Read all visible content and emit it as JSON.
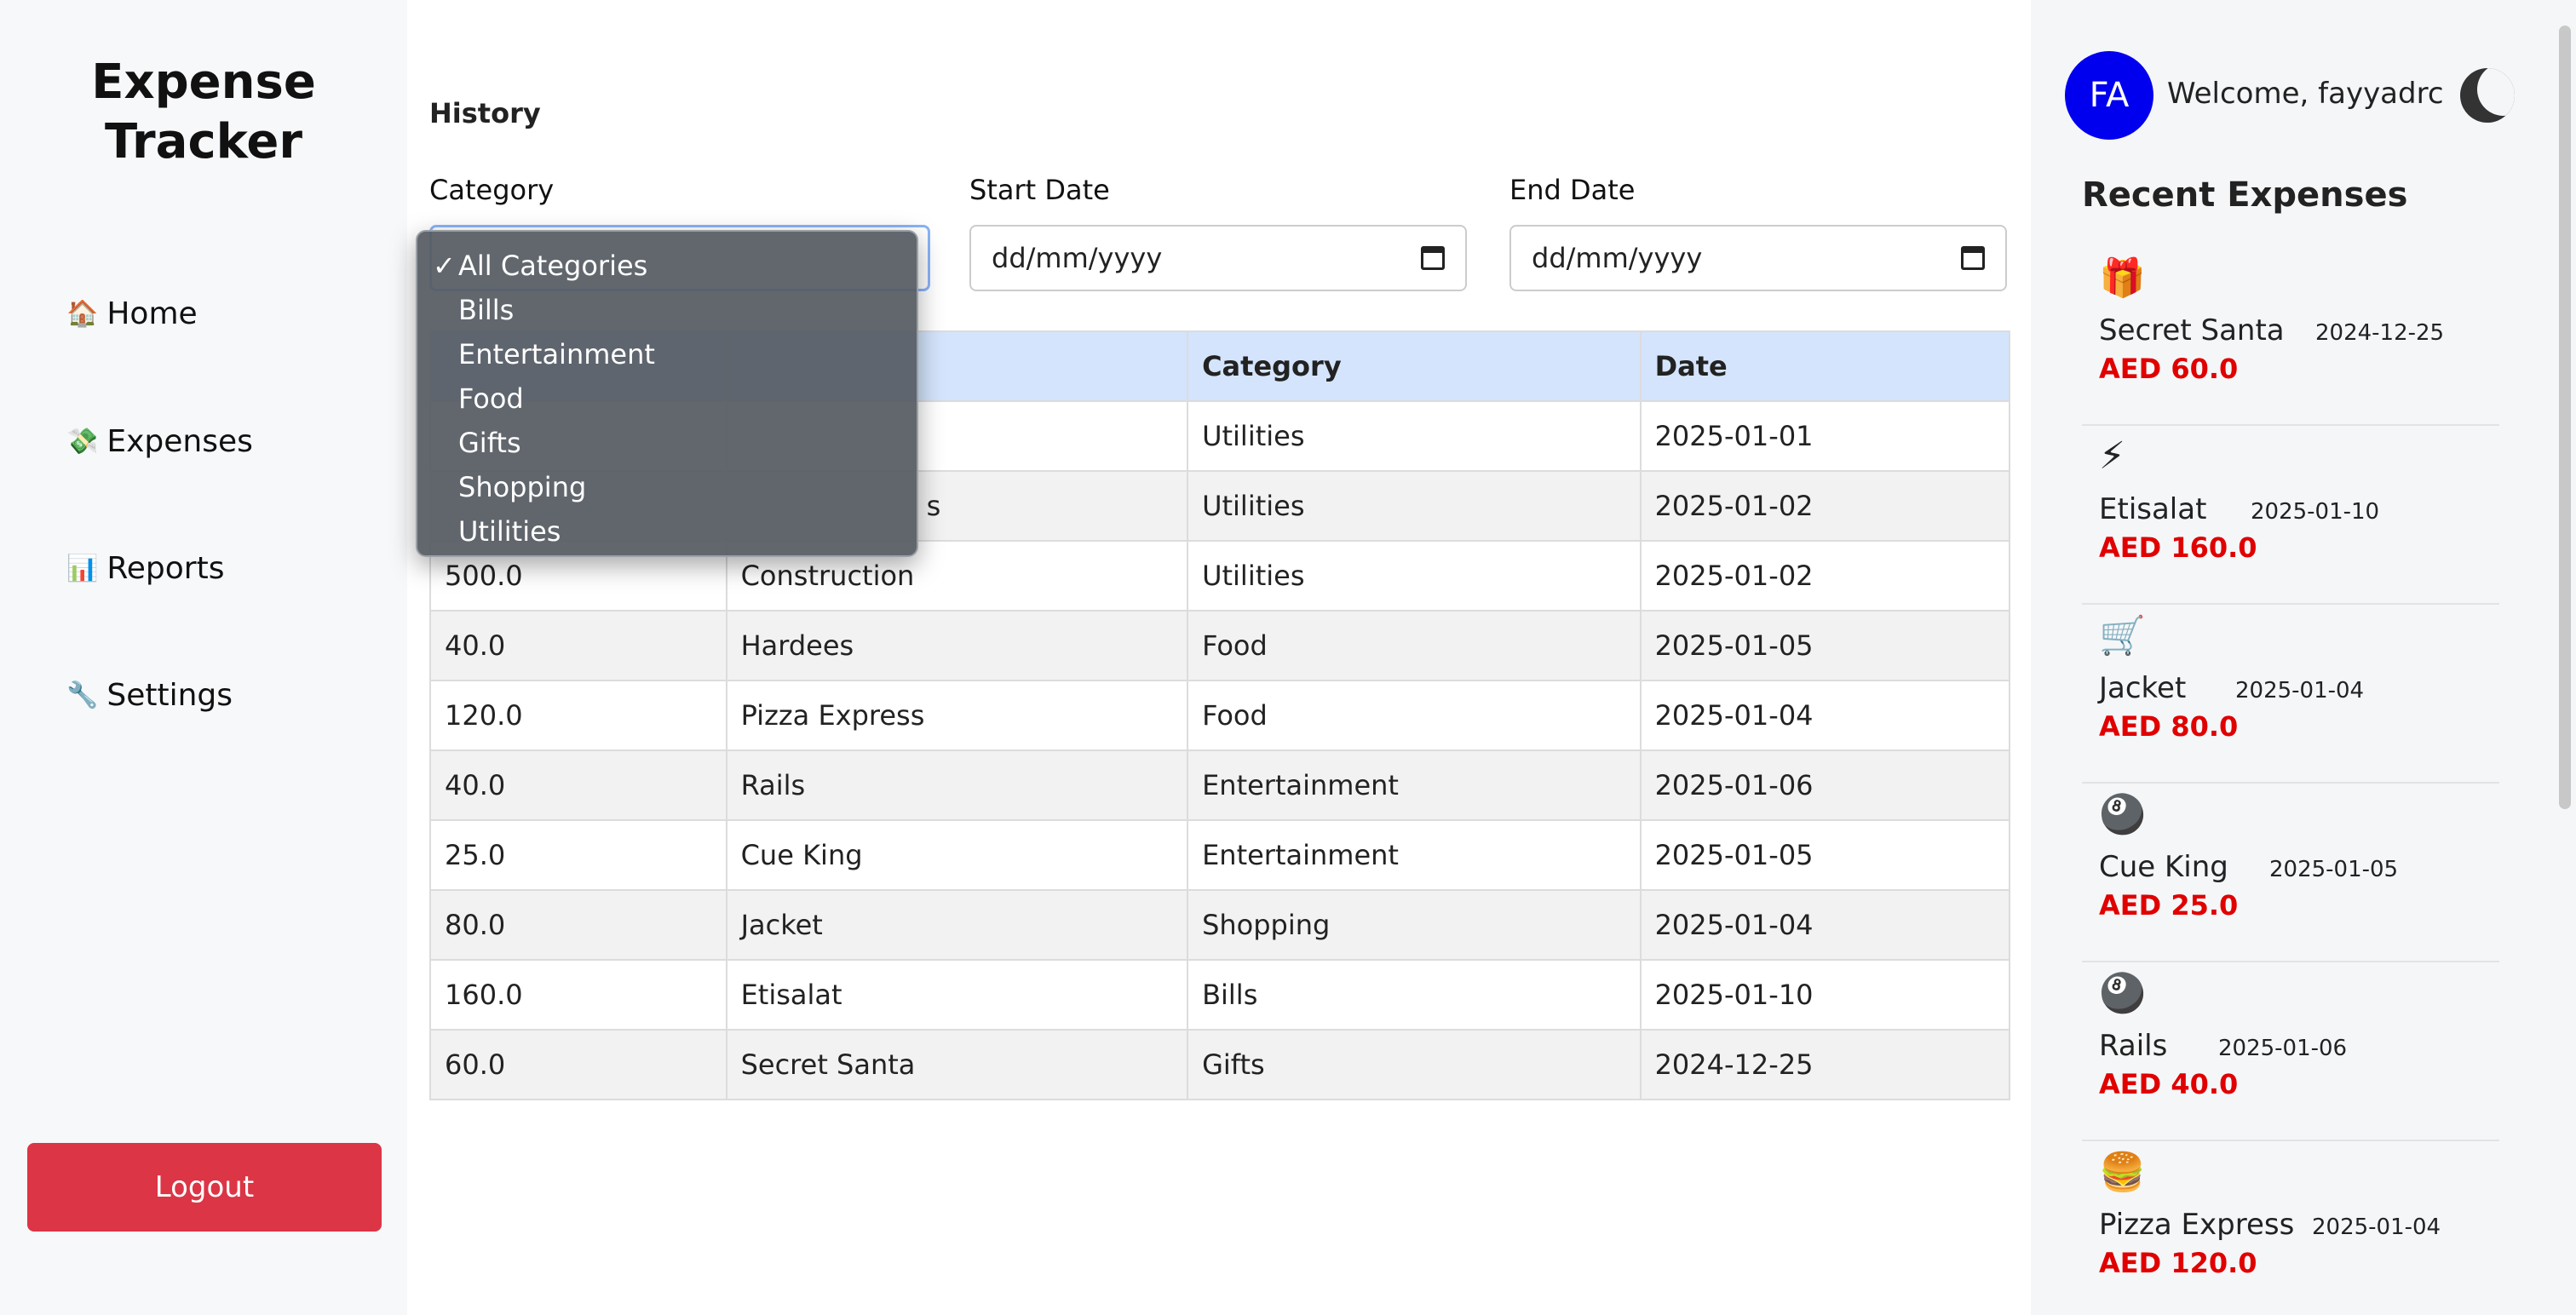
{
  "sidebar": {
    "brand_line1": "Expense",
    "brand_line2": "Tracker",
    "items": [
      {
        "icon": "🏠",
        "label": "Home"
      },
      {
        "icon": "💸",
        "label": "Expenses"
      },
      {
        "icon": "📊",
        "label": "Reports"
      },
      {
        "icon": "🔧",
        "label": "Settings"
      }
    ],
    "logout_label": "Logout"
  },
  "main": {
    "section_title": "History",
    "filters": {
      "category_label": "Category",
      "start_label": "Start Date",
      "start_placeholder": "dd/mm/yyyy",
      "end_label": "End Date",
      "end_placeholder": "dd/mm/yyyy"
    },
    "dropdown": {
      "selected": "All Categories",
      "options": [
        "All Categories",
        "Bills",
        "Entertainment",
        "Food",
        "Gifts",
        "Shopping",
        "Utilities"
      ]
    },
    "table": {
      "headers": [
        "",
        "",
        "Category",
        "Date"
      ],
      "rows": [
        [
          "",
          "",
          "Utilities",
          "2025-01-01"
        ],
        [
          "",
          "s",
          "Utilities",
          "2025-01-02"
        ],
        [
          "500.0",
          "Construction",
          "Utilities",
          "2025-01-02"
        ],
        [
          "40.0",
          "Hardees",
          "Food",
          "2025-01-05"
        ],
        [
          "120.0",
          "Pizza Express",
          "Food",
          "2025-01-04"
        ],
        [
          "40.0",
          "Rails",
          "Entertainment",
          "2025-01-06"
        ],
        [
          "25.0",
          "Cue King",
          "Entertainment",
          "2025-01-05"
        ],
        [
          "80.0",
          "Jacket",
          "Shopping",
          "2025-01-04"
        ],
        [
          "160.0",
          "Etisalat",
          "Bills",
          "2025-01-10"
        ],
        [
          "60.0",
          "Secret Santa",
          "Gifts",
          "2024-12-25"
        ]
      ]
    }
  },
  "right": {
    "avatar_initials": "FA",
    "welcome": "Welcome, fayyadrc",
    "theme_icon": "moon-icon",
    "recent_title": "Recent Expenses",
    "recent": [
      {
        "icon": "🎁",
        "name": "Secret Santa",
        "date": "2024-12-25",
        "amount": "AED 60.0"
      },
      {
        "icon": "⚡",
        "name": "Etisalat",
        "date": "2025-01-10",
        "amount": "AED 160.0"
      },
      {
        "icon": "🛒",
        "name": "Jacket",
        "date": "2025-01-04",
        "amount": "AED 80.0"
      },
      {
        "icon": "🎱",
        "name": "Cue King",
        "date": "2025-01-05",
        "amount": "AED 25.0"
      },
      {
        "icon": "🎱",
        "name": "Rails",
        "date": "2025-01-06",
        "amount": "AED 40.0"
      },
      {
        "icon": "🍔",
        "name": "Pizza Express",
        "date": "2025-01-04",
        "amount": "AED 120.0"
      }
    ]
  }
}
